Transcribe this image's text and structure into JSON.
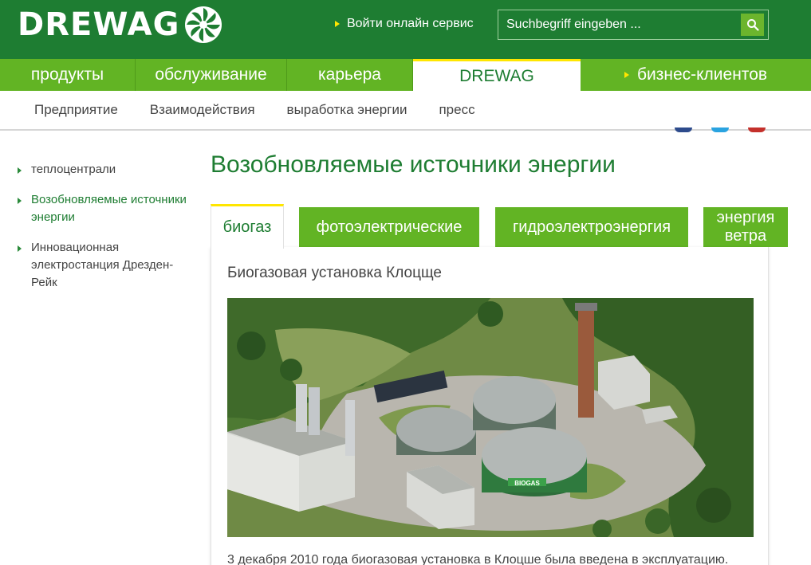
{
  "header": {
    "logo_text": "DREWAG",
    "online_service": "Войти онлайн сервис",
    "search_placeholder": "Suchbegriff eingeben ...",
    "colors": {
      "dark_green": "#1e7d32",
      "light_green": "#62b424",
      "accent_yellow": "#ffe600"
    }
  },
  "main_nav": [
    {
      "label": "продукты"
    },
    {
      "label": "обслуживание"
    },
    {
      "label": "карьера"
    },
    {
      "label": "DREWAG"
    },
    {
      "label": "бизнес-клиентов"
    }
  ],
  "sub_nav": [
    {
      "label": "Предприятие"
    },
    {
      "label": "Взаимодействия"
    },
    {
      "label": "выработка энергии"
    },
    {
      "label": "пресс"
    }
  ],
  "sidebar": {
    "items": [
      {
        "label": "теплоцентрали"
      },
      {
        "label": "Возобновляемые источники энергии"
      },
      {
        "label": "Инновационная электростанция Дрезден-Рейк"
      }
    ]
  },
  "content": {
    "title": "Возобновляемые источники энергии",
    "tabs": [
      {
        "label": "биогаз"
      },
      {
        "label": "фотоэлектрические"
      },
      {
        "label": "гидроэлектроэнергия"
      },
      {
        "label": "энергия ветра"
      }
    ],
    "panel_title": "Биогазовая установка Клоцще",
    "image_sign": "BIOGAS",
    "text": "3 декабря 2010 года биогазовая установка в Клоцше была введена в эксплуатацию."
  }
}
